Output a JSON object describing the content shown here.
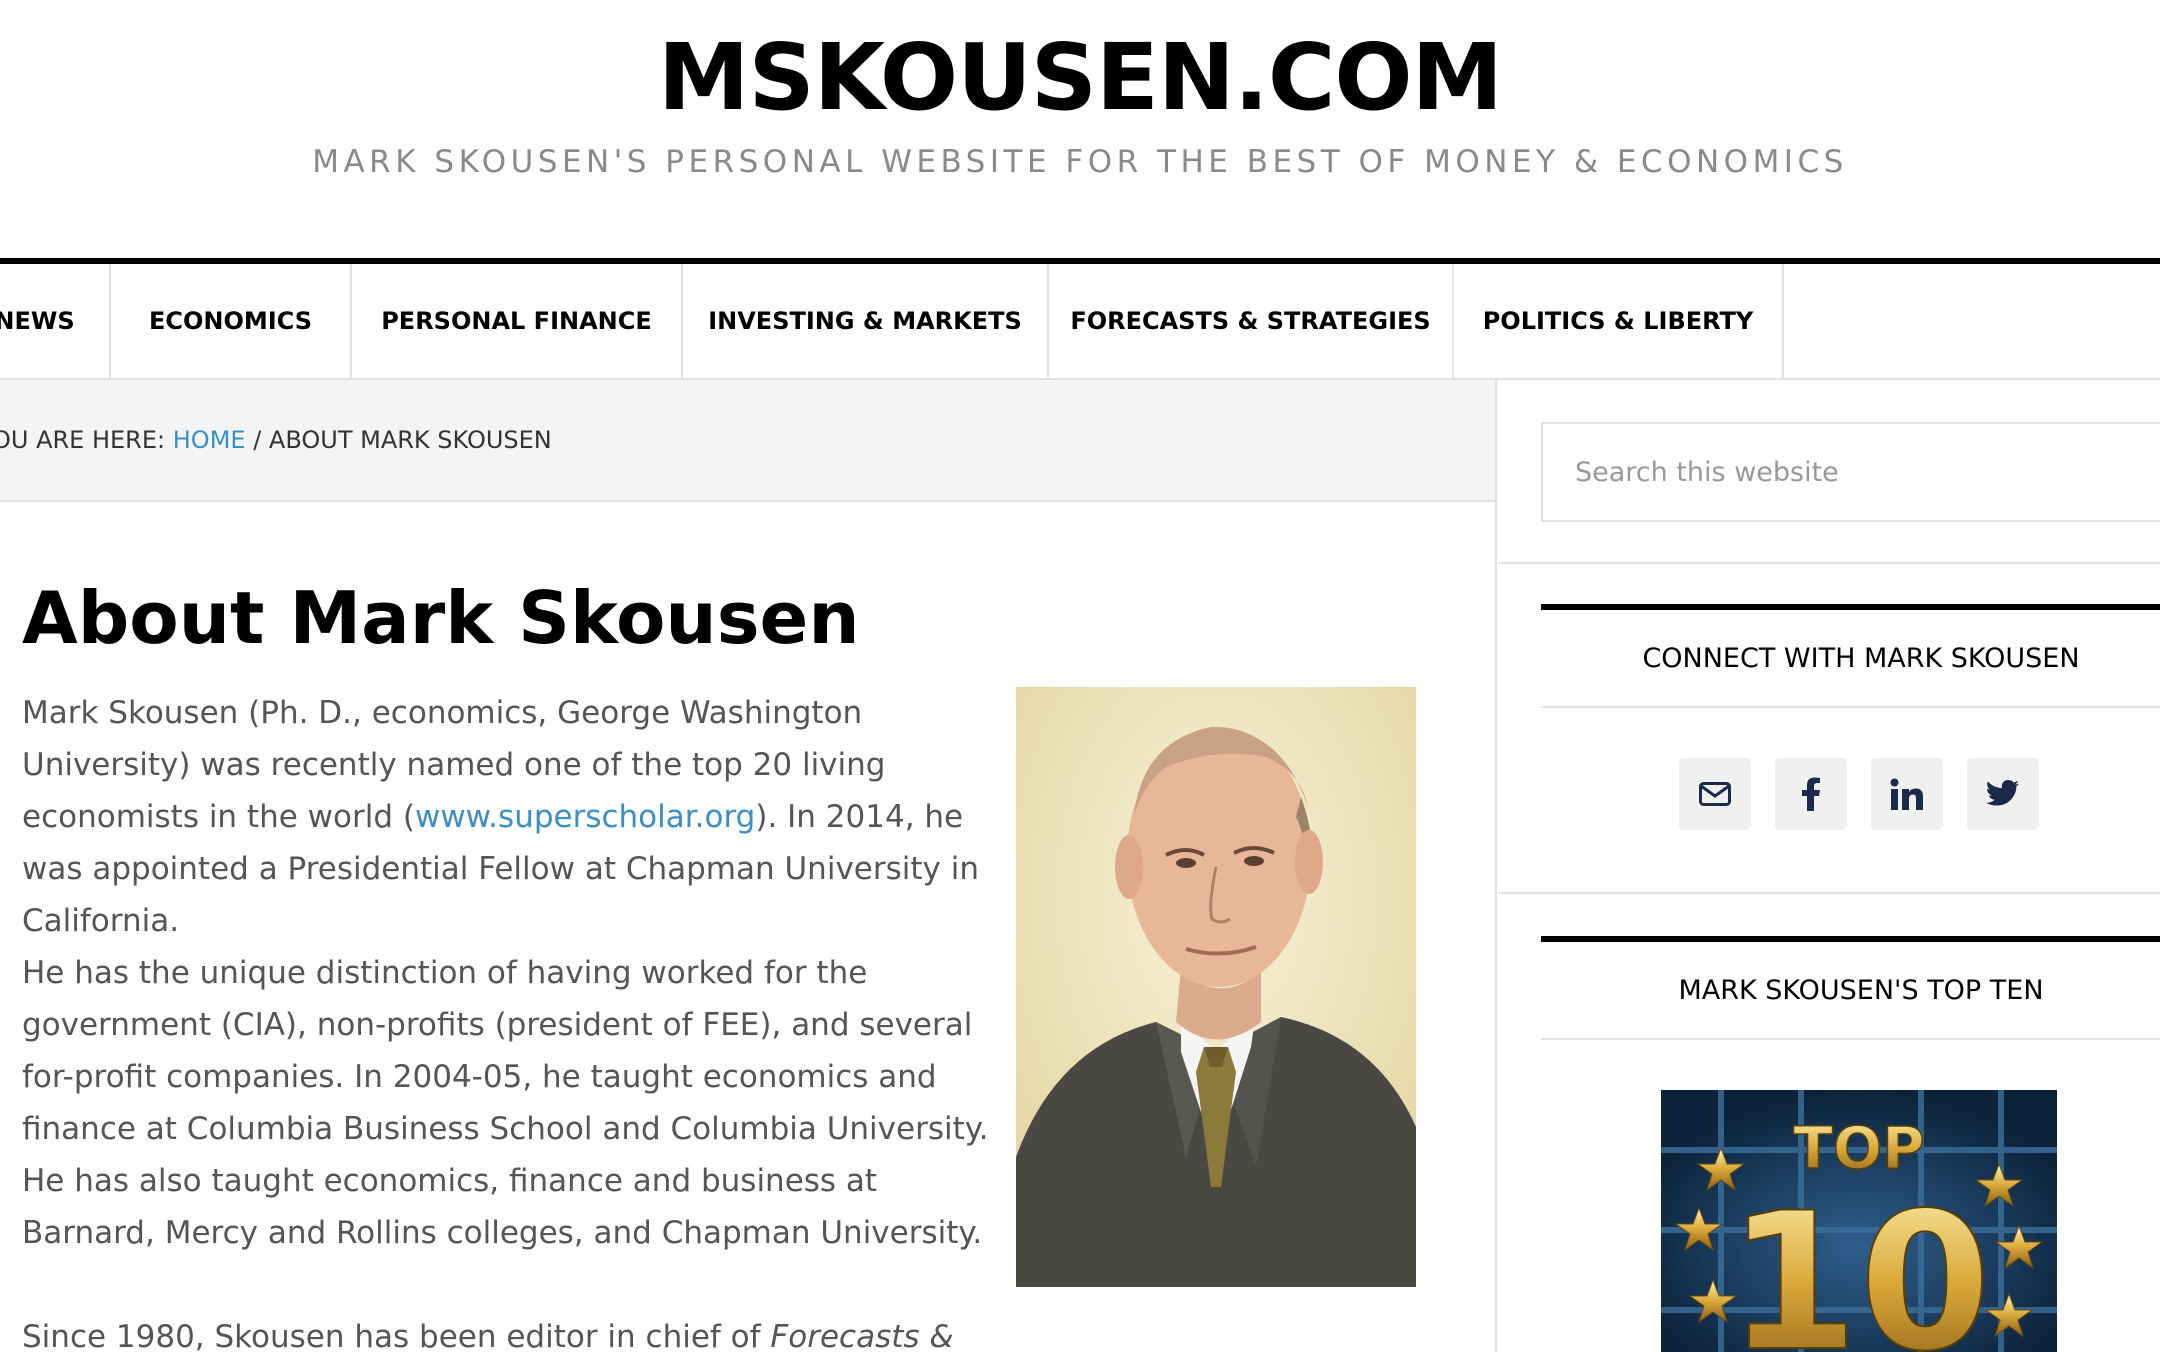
{
  "header": {
    "site_title": "MSKOUSEN.COM",
    "site_description": "MARK SKOUSEN'S PERSONAL WEBSITE FOR THE BEST OF MONEY & ECONOMICS"
  },
  "nav": {
    "items": [
      {
        "label": "NEWS"
      },
      {
        "label": "ECONOMICS"
      },
      {
        "label": "PERSONAL FINANCE"
      },
      {
        "label": "INVESTING & MARKETS"
      },
      {
        "label": "FORECASTS & STRATEGIES"
      },
      {
        "label": "POLITICS & LIBERTY"
      }
    ]
  },
  "breadcrumb": {
    "prefix": "OU ARE HERE: ",
    "home": "HOME",
    "separator": " / ",
    "current": "ABOUT MARK SKOUSEN"
  },
  "article": {
    "title": "About Mark Skousen",
    "p1_a": "Mark Skousen (Ph. D., economics, George Washington University) was recently named one of the top 20 living economists in the world (",
    "p1_link": "www.superscholar.org",
    "p1_b": ").  In 2014, he was appointed a Presidential Fellow at Chapman University in California.",
    "p2": "He has the unique distinction of having worked for the government (CIA), non-profits (president of FEE), and several for-profit companies.  In 2004-05, he taught economics and finance at Columbia Business School and Columbia University.  He has also taught economics, finance and business at Barnard, Mercy and Rollins colleges, and Chapman University.",
    "p3_a": "Since 1980, Skousen has been editor in chief of ",
    "p3_em": "Forecasts &"
  },
  "sidebar": {
    "search_placeholder": "Search this website",
    "connect_title": "CONNECT WITH MARK SKOUSEN",
    "social": [
      {
        "icon": "email-icon"
      },
      {
        "icon": "facebook-icon"
      },
      {
        "icon": "linkedin-icon"
      },
      {
        "icon": "twitter-icon"
      }
    ],
    "top_ten_title": "MARK SKOUSEN'S TOP TEN",
    "top_ten_image_text": {
      "top": "TOP",
      "number": "10"
    }
  },
  "colors": {
    "link": "#3a8fc8",
    "body_text": "#555555",
    "tagline": "#8a8a8a",
    "breadcrumb_bg": "#f4f4f4"
  }
}
